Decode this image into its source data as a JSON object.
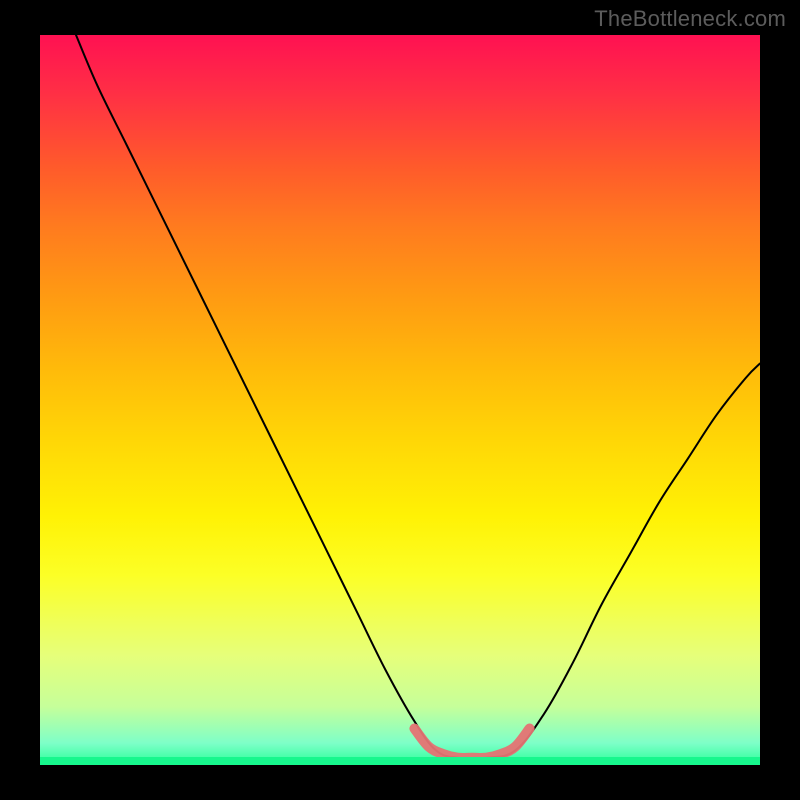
{
  "watermark": "TheBottleneck.com",
  "colors": {
    "accent_stroke": "#e57373",
    "curve_stroke": "#000000",
    "frame": "#000000",
    "gradient_top": "#ff1152",
    "gradient_mid": "#ffe605",
    "gradient_bottom": "#28ff98"
  },
  "chart_data": {
    "type": "line",
    "title": "",
    "xlabel": "",
    "ylabel": "",
    "xlim": [
      0,
      100
    ],
    "ylim": [
      0,
      100
    ],
    "grid": false,
    "legend": false,
    "series": [
      {
        "name": "bottleneck-curve",
        "x": [
          5,
          8,
          12,
          16,
          20,
          24,
          28,
          32,
          36,
          40,
          44,
          48,
          52,
          55,
          58,
          62,
          66,
          70,
          74,
          78,
          82,
          86,
          90,
          94,
          98,
          100
        ],
        "y": [
          100,
          93,
          85,
          77,
          69,
          61,
          53,
          45,
          37,
          29,
          21,
          13,
          6,
          2,
          1,
          1,
          2,
          7,
          14,
          22,
          29,
          36,
          42,
          48,
          53,
          55
        ]
      },
      {
        "name": "optimal-range-accent",
        "x": [
          52,
          54,
          56,
          58,
          60,
          62,
          64,
          66,
          68
        ],
        "y": [
          5,
          2.5,
          1.5,
          1,
          1,
          1,
          1.5,
          2.5,
          5
        ]
      }
    ],
    "annotations": []
  }
}
